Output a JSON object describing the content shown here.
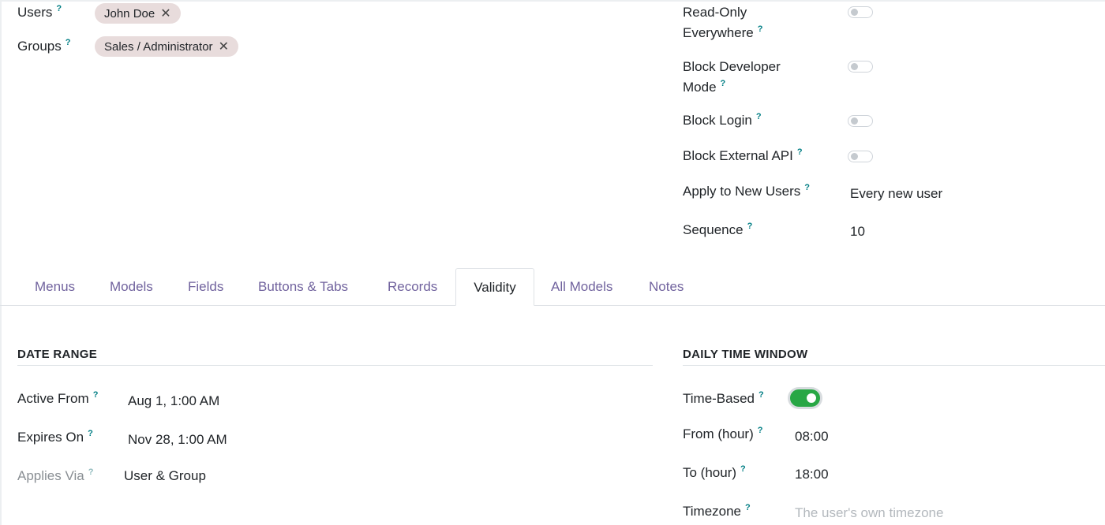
{
  "top_fields": {
    "users_label": "Users",
    "users_tags": [
      "John Doe"
    ],
    "groups_label": "Groups",
    "groups_tags": [
      "Sales / Administrator"
    ],
    "help_mark": "?",
    "tag_remove": "✕"
  },
  "options": {
    "read_only_label_1": "Read-Only",
    "read_only_label_2": "Everywhere",
    "read_only_enabled": false,
    "block_dev_label_1": "Block Developer",
    "block_dev_label_2": "Mode",
    "block_dev_enabled": false,
    "block_login_label": "Block Login",
    "block_login_enabled": false,
    "block_api_label": "Block External API",
    "block_api_enabled": false,
    "apply_new_users_label": "Apply to New Users",
    "apply_new_users_value": "Every new user",
    "sequence_label": "Sequence",
    "sequence_value": "10"
  },
  "tabs": [
    {
      "label": "Menus",
      "active": false
    },
    {
      "label": "Models",
      "active": false
    },
    {
      "label": "Fields",
      "active": false
    },
    {
      "label": "Buttons & Tabs",
      "active": false
    },
    {
      "label": "Records",
      "active": false
    },
    {
      "label": "Validity",
      "active": true
    },
    {
      "label": "All Models",
      "active": false
    },
    {
      "label": "Notes",
      "active": false
    }
  ],
  "date_range": {
    "title": "DATE RANGE",
    "active_from_label": "Active From",
    "active_from_value": "Aug 1, 1:00 AM",
    "expires_on_label": "Expires On",
    "expires_on_value": "Nov 28, 1:00 AM",
    "applies_via_label": "Applies Via",
    "applies_via_value": "User & Group"
  },
  "time_window": {
    "title": "DAILY TIME WINDOW",
    "time_based_label": "Time-Based",
    "time_based_enabled": true,
    "from_label": "From (hour)",
    "from_value": "08:00",
    "to_label": "To (hour)",
    "to_value": "18:00",
    "timezone_label": "Timezone",
    "timezone_placeholder": "The user's own timezone"
  },
  "colors": {
    "accent": "#71639e",
    "help": "#017e84",
    "toggle_on": "#28a745",
    "tag_bg": "#e8dcdc"
  }
}
